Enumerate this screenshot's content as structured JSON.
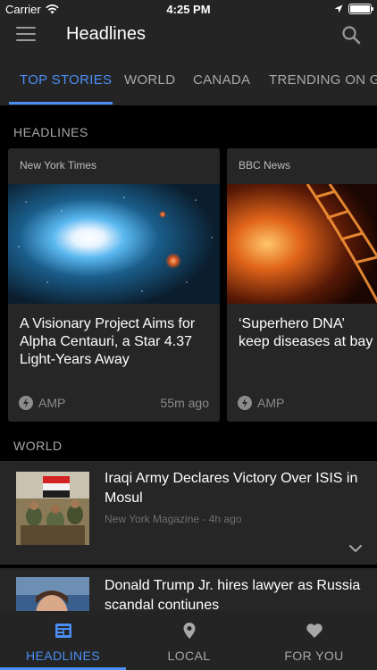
{
  "status_bar": {
    "carrier": "Carrier",
    "time": "4:25 PM",
    "icons": [
      "wifi-icon",
      "location-arrow-icon",
      "battery-icon"
    ]
  },
  "app_bar": {
    "title": "Headlines",
    "icons": [
      "hamburger-menu-icon",
      "search-icon"
    ]
  },
  "tabs": [
    {
      "label": "TOP STORIES",
      "active": true
    },
    {
      "label": "WORLD",
      "active": false
    },
    {
      "label": "CANADA",
      "active": false
    },
    {
      "label": "TRENDING ON GO",
      "active": false
    }
  ],
  "headlines_section": {
    "label": "HEADLINES",
    "cards": [
      {
        "source": "New York Times",
        "title": "A Visionary Project Aims for Alpha Centauri, a Star 4.37 Light-Years Away",
        "amp_label": "AMP",
        "time": "55m ago",
        "image": "star-field-image"
      },
      {
        "source": "BBC News",
        "title": "‘Superhero DNA’ keep diseases at bay",
        "amp_label": "AMP",
        "time": "",
        "image": "dna-helix-image"
      }
    ]
  },
  "world_section": {
    "label": "WORLD",
    "stories": [
      {
        "title": "Iraqi Army Declares Victory Over ISIS in Mosul",
        "source": "New York Magazine",
        "separator": " - ",
        "time": "4h ago",
        "image": "soldiers-flag-photo"
      },
      {
        "title": "Donald Trump Jr. hires lawyer as Russia scandal contiunes",
        "image": "person-portrait-photo"
      }
    ]
  },
  "bottom_nav": [
    {
      "label": "HEADLINES",
      "icon": "newspaper-icon",
      "active": true
    },
    {
      "label": "LOCAL",
      "icon": "map-pin-icon",
      "active": false
    },
    {
      "label": "FOR YOU",
      "icon": "heart-icon",
      "active": false
    }
  ],
  "colors": {
    "accent": "#4b8ef5",
    "bar_background": "#242424",
    "card_background": "#262626",
    "page_background": "#000000",
    "muted_text": "#a8a8a8"
  }
}
